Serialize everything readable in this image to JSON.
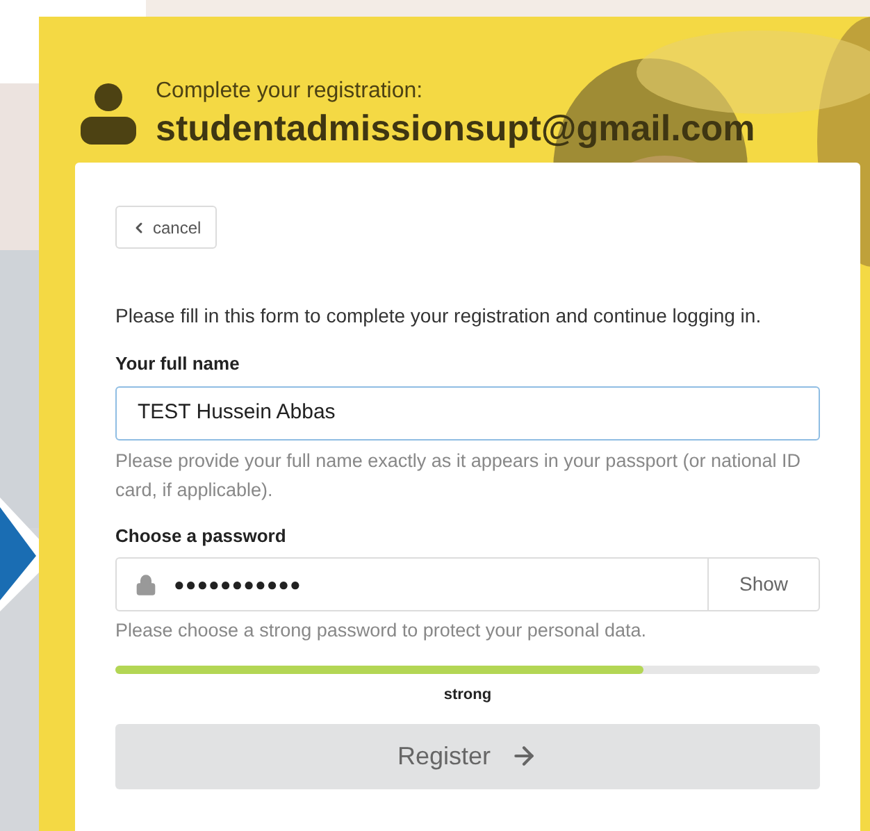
{
  "header": {
    "subtitle": "Complete your registration:",
    "email": "studentadmissionsupt@gmail.com"
  },
  "form": {
    "cancel": "cancel",
    "intro": "Please fill in this form to complete your registration and continue logging in.",
    "name_field": {
      "label": "Your full name",
      "value": "TEST Hussein Abbas",
      "help": "Please provide your full name exactly as it appears in your passport (or national ID card, if applicable).",
      "focused": true
    },
    "password_field": {
      "label": "Choose a password",
      "value": "●●●●●●●●●●●",
      "show_button": "Show",
      "help": "Please choose a strong password to protect your personal data."
    },
    "strength": {
      "level": 0.75,
      "label": "strong"
    },
    "register_button": {
      "label": "Register",
      "disabled": true
    }
  }
}
